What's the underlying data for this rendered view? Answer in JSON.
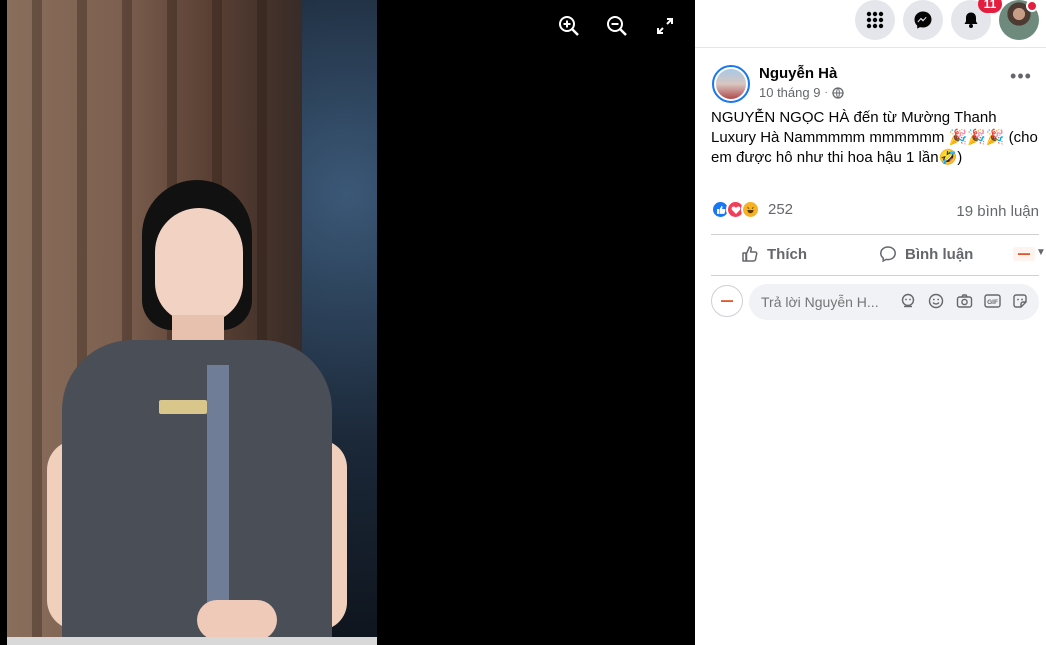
{
  "viewer": {
    "icons": [
      "zoom-in-icon",
      "zoom-out-icon",
      "fullscreen-icon"
    ]
  },
  "topbar": {
    "notification_count": "11",
    "icons": [
      "menu-grid-icon",
      "messenger-icon",
      "bell-icon"
    ]
  },
  "post": {
    "author": "Nguyễn Hà",
    "time": "10 tháng 9",
    "text": "NGUYỄN NGỌC HÀ đến từ Mường Thanh Luxury Hà Nammmmm mmmmmm 🎉🎉🎉 (cho em được hô như thi hoa hậu 1 lần🤣)",
    "reaction_count": "252",
    "comment_count": "19 bình luận",
    "actions": {
      "like": "Thích",
      "comment": "Bình luận"
    },
    "reply_placeholder": "Trả lời Nguyễn H..."
  },
  "colors": {
    "accent": "#1877f2",
    "badge": "#e41e3f",
    "text_secondary": "#65676b"
  }
}
